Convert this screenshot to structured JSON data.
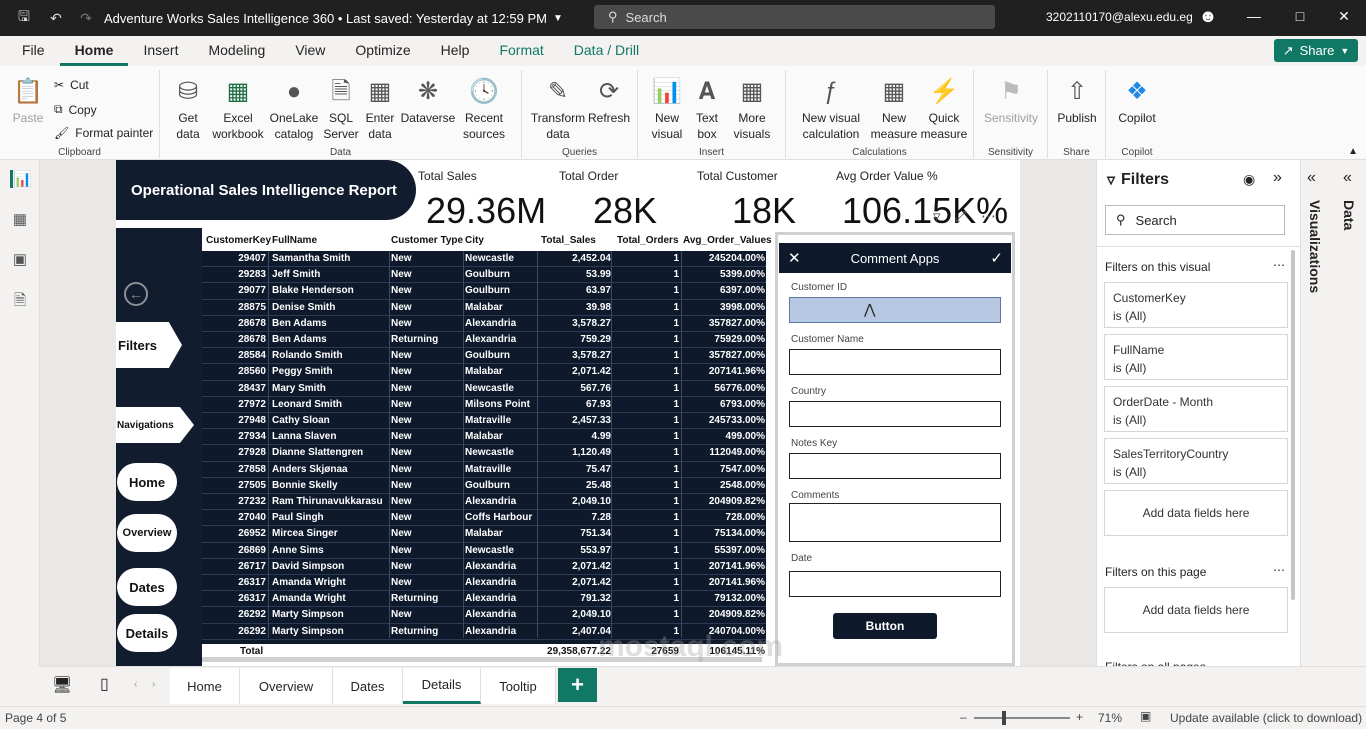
{
  "window": {
    "title": "Adventure Works Sales Intelligence 360 • Last saved: Yesterday at 12:59 PM",
    "search_placeholder": "Search",
    "user": "3202110170@alexu.edu.eg"
  },
  "menu": [
    "File",
    "Home",
    "Insert",
    "Modeling",
    "View",
    "Optimize",
    "Help",
    "Format",
    "Data / Drill"
  ],
  "share_label": "Share",
  "ribbon": {
    "clipboard": {
      "paste": "Paste",
      "cut": "Cut",
      "copy": "Copy",
      "format_painter": "Format painter",
      "label": "Clipboard"
    },
    "data": {
      "get_data": "Get data",
      "excel": "Excel workbook",
      "onelake": "OneLake catalog",
      "sql": "SQL Server",
      "enter_data": "Enter data",
      "dataverse": "Dataverse",
      "recent": "Recent sources",
      "label": "Data"
    },
    "queries": {
      "transform": "Transform data",
      "refresh": "Refresh",
      "label": "Queries"
    },
    "insert": {
      "new_visual": "New visual",
      "text_box": "Text box",
      "more_visuals": "More visuals",
      "label": "Insert"
    },
    "calculations": {
      "new_visual_calc": "New visual calculation",
      "new_measure": "New measure",
      "quick_measure": "Quick measure",
      "label": "Calculations"
    },
    "sensitivity": {
      "btn": "Sensitivity",
      "label": "Sensitivity"
    },
    "share": {
      "publish": "Publish",
      "label": "Share"
    },
    "copilot": {
      "btn": "Copilot",
      "label": "Copilot"
    }
  },
  "report": {
    "title": "Operational Sales Intelligence Report",
    "kpis": [
      {
        "label": "Total Sales",
        "value": "29.36M"
      },
      {
        "label": "Total Order",
        "value": "28K"
      },
      {
        "label": "Total Customer",
        "value": "18K"
      },
      {
        "label": "Avg Order Value %",
        "value": "106.15K%"
      }
    ],
    "nav": {
      "filters": "Filters",
      "navigations": "Navigations",
      "home": "Home",
      "overview": "Overview",
      "dates": "Dates",
      "details": "Details"
    },
    "table": {
      "headers": [
        "CustomerKey",
        "FullName",
        "Customer Type",
        "City",
        "Total_Sales",
        "Total_Orders",
        "Avg_Order_Values"
      ],
      "rows": [
        [
          "29407",
          "Samantha Smith",
          "New",
          "Newcastle",
          "2,452.04",
          "1",
          "245204.00%"
        ],
        [
          "29283",
          "Jeff Smith",
          "New",
          "Goulburn",
          "53.99",
          "1",
          "5399.00%"
        ],
        [
          "29077",
          "Blake Henderson",
          "New",
          "Goulburn",
          "63.97",
          "1",
          "6397.00%"
        ],
        [
          "28875",
          "Denise Smith",
          "New",
          "Malabar",
          "39.98",
          "1",
          "3998.00%"
        ],
        [
          "28678",
          "Ben Adams",
          "New",
          "Alexandria",
          "3,578.27",
          "1",
          "357827.00%"
        ],
        [
          "28678",
          "Ben Adams",
          "Returning",
          "Alexandria",
          "759.29",
          "1",
          "75929.00%"
        ],
        [
          "28584",
          "Rolando Smith",
          "New",
          "Goulburn",
          "3,578.27",
          "1",
          "357827.00%"
        ],
        [
          "28560",
          "Peggy Smith",
          "New",
          "Malabar",
          "2,071.42",
          "1",
          "207141.96%"
        ],
        [
          "28437",
          "Mary Smith",
          "New",
          "Newcastle",
          "567.76",
          "1",
          "56776.00%"
        ],
        [
          "27972",
          "Leonard Smith",
          "New",
          "Milsons Point",
          "67.93",
          "1",
          "6793.00%"
        ],
        [
          "27948",
          "Cathy Sloan",
          "New",
          "Matraville",
          "2,457.33",
          "1",
          "245733.00%"
        ],
        [
          "27934",
          "Lanna Slaven",
          "New",
          "Malabar",
          "4.99",
          "1",
          "499.00%"
        ],
        [
          "27928",
          "Dianne Slattengren",
          "New",
          "Newcastle",
          "1,120.49",
          "1",
          "112049.00%"
        ],
        [
          "27858",
          "Anders Skjønaa",
          "New",
          "Matraville",
          "75.47",
          "1",
          "7547.00%"
        ],
        [
          "27505",
          "Bonnie Skelly",
          "New",
          "Goulburn",
          "25.48",
          "1",
          "2548.00%"
        ],
        [
          "27232",
          "Ram Thirunavukkarasu",
          "New",
          "Alexandria",
          "2,049.10",
          "1",
          "204909.82%"
        ],
        [
          "27040",
          "Paul Singh",
          "New",
          "Coffs Harbour",
          "7.28",
          "1",
          "728.00%"
        ],
        [
          "26952",
          "Mircea Singer",
          "New",
          "Malabar",
          "751.34",
          "1",
          "75134.00%"
        ],
        [
          "26869",
          "Anne Sims",
          "New",
          "Newcastle",
          "553.97",
          "1",
          "55397.00%"
        ],
        [
          "26717",
          "David Simpson",
          "New",
          "Alexandria",
          "2,071.42",
          "1",
          "207141.96%"
        ],
        [
          "26317",
          "Amanda Wright",
          "New",
          "Alexandria",
          "2,071.42",
          "1",
          "207141.96%"
        ],
        [
          "26317",
          "Amanda Wright",
          "Returning",
          "Alexandria",
          "791.32",
          "1",
          "79132.00%"
        ],
        [
          "26292",
          "Marty Simpson",
          "New",
          "Alexandria",
          "2,049.10",
          "1",
          "204909.82%"
        ],
        [
          "26292",
          "Marty Simpson",
          "Returning",
          "Alexandria",
          "2,407.04",
          "1",
          "240704.00%"
        ]
      ],
      "total": {
        "label": "Total",
        "sales": "29,358,677.22",
        "orders": "27659",
        "avg": "106145.11%"
      }
    },
    "comment_app": {
      "title": "Comment Apps",
      "fields": [
        "Customer ID",
        "Customer Name",
        "Country",
        "Notes Key",
        "Comments",
        "Date"
      ],
      "button": "Button"
    }
  },
  "filters": {
    "title": "Filters",
    "search_placeholder": "Search",
    "on_visual": "Filters on this visual",
    "cards": [
      {
        "name": "CustomerKey",
        "state": "is (All)"
      },
      {
        "name": "FullName",
        "state": "is (All)"
      },
      {
        "name": "OrderDate - Month",
        "state": "is (All)"
      },
      {
        "name": "SalesTerritoryCountry",
        "state": "is (All)"
      }
    ],
    "add_fields": "Add data fields here",
    "on_page": "Filters on this page",
    "on_all": "Filters on all pages"
  },
  "side_panes": {
    "visualizations": "Visualizations",
    "data": "Data"
  },
  "pages": [
    "Home",
    "Overview",
    "Dates",
    "Details",
    "Tooltip"
  ],
  "status": {
    "page": "Page 4 of 5",
    "zoom": "71%",
    "update": "Update available (click to download)"
  },
  "watermark": "mostaql.com"
}
